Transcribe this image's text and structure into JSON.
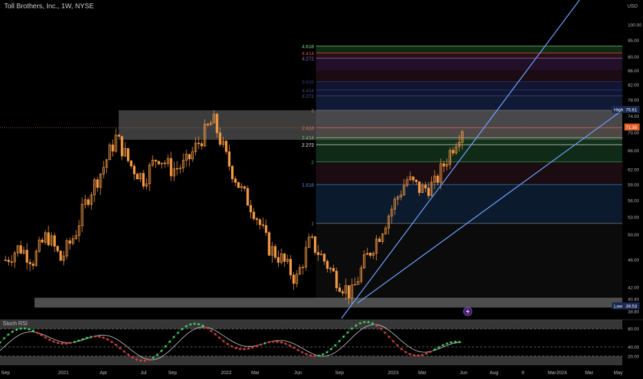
{
  "header": {
    "title": "Toll Brothers, Inc., 1W, NYSE",
    "currency": "USD"
  },
  "price_axis": {
    "labels": [
      "100.00",
      "95.00",
      "90.00",
      "86.00",
      "82.00",
      "78.00",
      "74.00",
      "70.00",
      "66.00",
      "62.00",
      "59.00",
      "56.00",
      "53.00",
      "50.00",
      "46.00",
      "42.00",
      "40.40",
      "38.80"
    ],
    "values": [
      100,
      95,
      90,
      86,
      82,
      78,
      74,
      70,
      66,
      62,
      59,
      56,
      53,
      50,
      46,
      42,
      40.4,
      38.8
    ]
  },
  "badges": {
    "high_label": "High",
    "high_value": "75.61",
    "last_value": "71.35",
    "low_label": "Low",
    "low_value": "39.53"
  },
  "fib_levels": [
    {
      "label": "4.618",
      "price": 93.2,
      "color": "#7fdc7f"
    },
    {
      "label": "4.414",
      "price": 91.1,
      "color": "#e05050"
    },
    {
      "label": "4.272",
      "price": 89.6,
      "color": "#b070d0"
    },
    {
      "label": "3.618",
      "price": 82.9,
      "color": "#303a70"
    },
    {
      "label": "3.414",
      "price": 80.6,
      "color": "#3a4a80"
    },
    {
      "label": "3.272",
      "price": 79.1,
      "color": "#4a5a90"
    },
    {
      "label": "3",
      "price": 75.4,
      "color": "#808080"
    },
    {
      "label": "2.618",
      "price": 71.2,
      "color": "#e07070"
    },
    {
      "label": "2.414",
      "price": 68.9,
      "color": "#80c080"
    },
    {
      "label": "2.272",
      "price": 67.3,
      "color": "#ffffff"
    },
    {
      "label": "2",
      "price": 63.6,
      "color": "#40b060"
    },
    {
      "label": "1.618",
      "price": 59.0,
      "color": "#4a90e0"
    },
    {
      "label": "1",
      "price": 51.9,
      "color": "#808080"
    }
  ],
  "oscillator": {
    "title": "Stoch RSI",
    "labels": [
      "80.00",
      "40.00",
      "20.00"
    ],
    "values": [
      80,
      40,
      20
    ]
  },
  "time_axis": {
    "labels": [
      "Sep",
      "2021",
      "Apr",
      "Jul",
      "Sep",
      "2022",
      "Mar",
      "Jun",
      "Sep",
      "2023",
      "Mar",
      "Jun",
      "Aug",
      "9",
      "Mar",
      "2024",
      "Mar",
      "May"
    ]
  },
  "chart_data": {
    "type": "candlestick",
    "title": "Toll Brothers, Inc., 1W, NYSE",
    "ylim": [
      37.5,
      110
    ],
    "scale": "log",
    "grid": false,
    "high": 75.61,
    "low": 39.53,
    "last": 71.35,
    "rising_color": "#f59a45",
    "falling_color": "#f59a45",
    "series": [
      {
        "x": "Sep 2020",
        "close": 46
      },
      {
        "x": "Oct 2020",
        "close": 48
      },
      {
        "x": "Nov 2020",
        "close": 46
      },
      {
        "x": "Dec 2020",
        "close": 50
      },
      {
        "x": "Jan 2021",
        "close": 46
      },
      {
        "x": "Feb 2021",
        "close": 50
      },
      {
        "x": "Mar 2021",
        "close": 57
      },
      {
        "x": "Apr 2021",
        "close": 62
      },
      {
        "x": "May 2021",
        "close": 69
      },
      {
        "x": "Jun 2021",
        "close": 63
      },
      {
        "x": "Jul 2021",
        "close": 60
      },
      {
        "x": "Aug 2021",
        "close": 65
      },
      {
        "x": "Sep 2021",
        "close": 62
      },
      {
        "x": "Oct 2021",
        "close": 63
      },
      {
        "x": "Nov 2021",
        "close": 68
      },
      {
        "x": "Dec 2021",
        "close": 73
      },
      {
        "x": "Jan 2022",
        "close": 64
      },
      {
        "x": "Feb 2022",
        "close": 58
      },
      {
        "x": "Mar 2022",
        "close": 54
      },
      {
        "x": "Apr 2022",
        "close": 48
      },
      {
        "x": "May 2022",
        "close": 46
      },
      {
        "x": "Jun 2022",
        "close": 43
      },
      {
        "x": "Jul 2022",
        "close": 49
      },
      {
        "x": "Aug 2022",
        "close": 46
      },
      {
        "x": "Sep 2022",
        "close": 43
      },
      {
        "x": "Oct 2022",
        "close": 41
      },
      {
        "x": "Nov 2022",
        "close": 46
      },
      {
        "x": "Dec 2022",
        "close": 50
      },
      {
        "x": "Jan 2023",
        "close": 55
      },
      {
        "x": "Feb 2023",
        "close": 60
      },
      {
        "x": "Mar 2023",
        "close": 58
      },
      {
        "x": "Apr 2023",
        "close": 59
      },
      {
        "x": "May 2023",
        "close": 65
      },
      {
        "x": "Jun 2023",
        "close": 71.35
      }
    ]
  }
}
